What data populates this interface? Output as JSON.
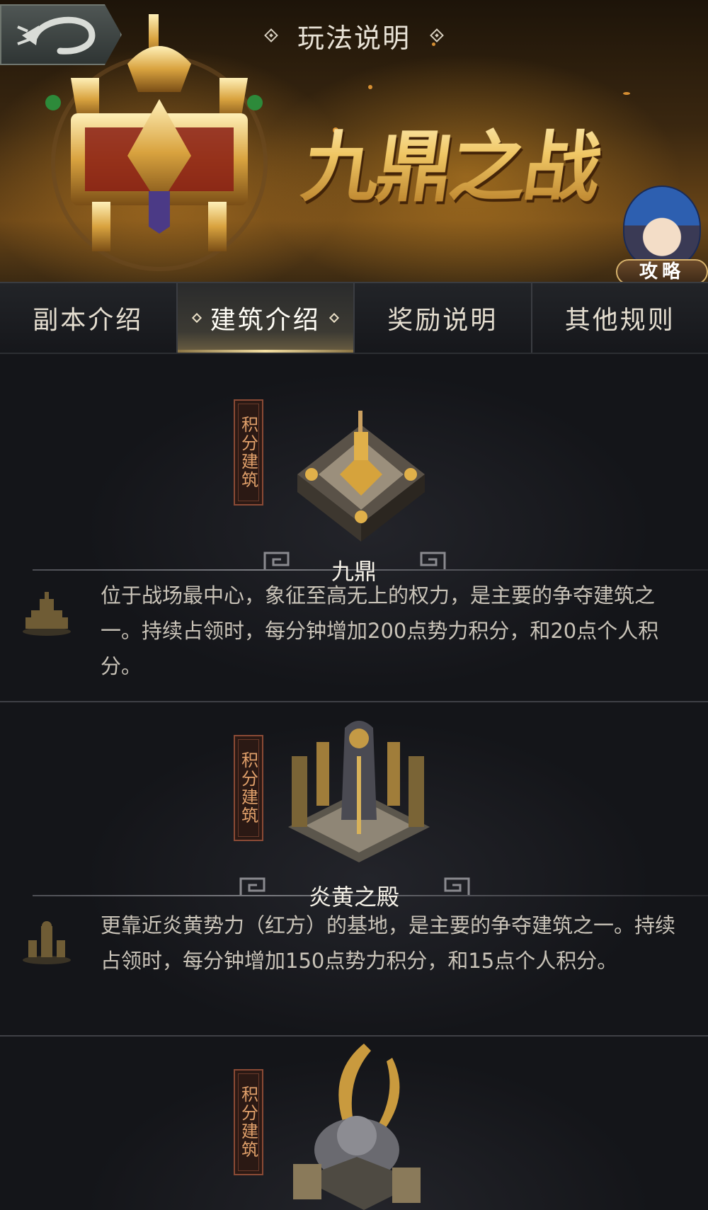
{
  "header": {
    "title": "玩法说明",
    "logo_text": "九鼎之战",
    "guide_label": "攻略"
  },
  "tabs": [
    {
      "label": "副本介绍",
      "active": false
    },
    {
      "label": "建筑介绍",
      "active": true
    },
    {
      "label": "奖励说明",
      "active": false
    },
    {
      "label": "其他规则",
      "active": false
    }
  ],
  "buildings": [
    {
      "tag": "积分建筑",
      "name": "九鼎",
      "description": "位于战场最中心，象征至高无上的权力，是主要的争夺建筑之一。持续占领时，每分钟增加200点势力积分，和20点个人积分。"
    },
    {
      "tag": "积分建筑",
      "name": "炎黄之殿",
      "description": "更靠近炎黄势力（红方）的基地，是主要的争夺建筑之一。持续占领时，每分钟增加150点势力积分，和15点个人积分。"
    },
    {
      "tag": "积分建筑"
    }
  ]
}
